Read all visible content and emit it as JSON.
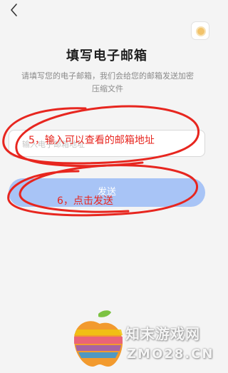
{
  "header": {
    "back_label": "<",
    "corner_icon": "app-badge-icon"
  },
  "main": {
    "title": "填写电子邮箱",
    "description": "请填写您的电子邮箱，我们会给您的邮箱发送加密压缩文件",
    "email_placeholder": "输入电子邮箱地址",
    "email_value": "",
    "send_label": "发送"
  },
  "annotations": {
    "step5": "5，输入可以查看的邮箱地址",
    "step6": "6，点击发送",
    "color": "#e7261f"
  },
  "watermark": {
    "line1": "知末游戏网",
    "line2": "ZMO28.CN"
  },
  "colors": {
    "send_button": "#a8c4f6",
    "annotation_red": "#e7261f"
  }
}
